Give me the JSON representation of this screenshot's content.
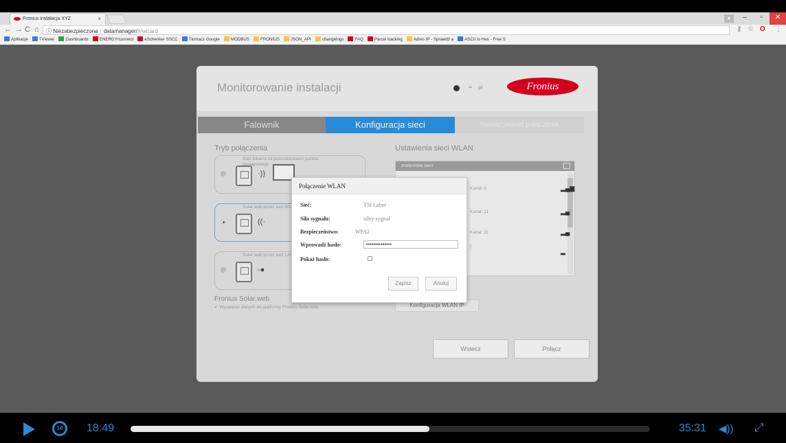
{
  "browser": {
    "tab_title": "Fronius instalacja XYZ",
    "tab_close": "×",
    "address_security": "Niezabezpieczona",
    "address_host": "datamanager/",
    "address_path": "#/wizard",
    "bookmarks": [
      {
        "label": "Aplikacje",
        "icon": "apps-grid-icon",
        "color": "#3a7bd5"
      },
      {
        "label": "TViewer",
        "icon": "tviewer-icon",
        "color": "#3a7bd5"
      },
      {
        "label": "Dashboards",
        "icon": "dashboards-icon",
        "color": "#2e9e44"
      },
      {
        "label": "ENERGY/connect",
        "icon": "fronius-icon",
        "color": "#d2001e"
      },
      {
        "label": "eSchenker SSCC",
        "icon": "eschenker-icon",
        "color": "#d2001e"
      },
      {
        "label": "Tłumacz Google",
        "icon": "translate-icon",
        "color": "#3a7bd5"
      },
      {
        "label": "MODBUS",
        "icon": "folder-icon",
        "color": "#f5c542"
      },
      {
        "label": "FRONIUS",
        "icon": "folder-icon",
        "color": "#f5c542"
      },
      {
        "label": "JSON_API",
        "icon": "folder-icon",
        "color": "#f5c542"
      },
      {
        "label": "changelogs",
        "icon": "folder-icon",
        "color": "#f5c542"
      },
      {
        "label": "FAQ",
        "icon": "fronius-icon",
        "color": "#d2001e"
      },
      {
        "label": "Parcel tracking",
        "icon": "parcel-icon",
        "color": "#d2001e"
      },
      {
        "label": "Adres IP - Sprawdź a",
        "icon": "ip-icon",
        "color": "#f5c542"
      },
      {
        "label": "ASCII to Hex - Free S",
        "icon": "ascii-icon",
        "color": "#3a7bd5"
      }
    ]
  },
  "app": {
    "title": "Monitorowanie instalacji",
    "lang": "pl",
    "logo": "Fronius",
    "steps": [
      "Falownik",
      "Konfiguracja sieci",
      "Nawiązywanie połączenia"
    ],
    "left": {
      "title": "Tryb połączenia",
      "opt1_desc": "Sieć lokalna za pośrednictwem punktu dostępowego",
      "opt2_desc": "Solar.web przez sieć WLAN",
      "opt3_desc": "Solar.web przez sieć LAN",
      "solarweb_title": "Fronius Solar.web",
      "solarweb_cb": "Wysyłanie danych do platformy Fronius Solar.web"
    },
    "right": {
      "title": "Ustawienia sieci WLAN",
      "list_head": "znalezione sieci",
      "rows": [
        {
          "channel": "Kanał: 6",
          "bars": "▂▄▆"
        },
        {
          "channel": "Kanał: 11",
          "bars": "▂▄"
        },
        {
          "channel": "Kanał: 11",
          "bars": "▂▄"
        },
        {
          "channel": "]",
          "bars": "▂"
        }
      ],
      "wlan_ip_btn": "Konfiguracja WLAN IP"
    },
    "back_btn": "Wstecz",
    "connect_btn": "Połącz"
  },
  "modal": {
    "title": "Połączenie WLAN",
    "network_label": "Sieć:",
    "network_value": "TSI Labor",
    "signal_label": "Siła sygnału:",
    "signal_value": "silny sygnał",
    "security_label": "Bezpieczeństwo:",
    "security_value": "WPA2",
    "password_label": "Wprowadź hasło:",
    "password_value": "••••••••••••••",
    "show_label": "Pokaż hasło:",
    "save_btn": "Zapisz",
    "cancel_btn": "Anuluj"
  },
  "player": {
    "current_time": "18:49",
    "total_time": "35:31",
    "replay_label": "10",
    "progress": 0.575
  }
}
